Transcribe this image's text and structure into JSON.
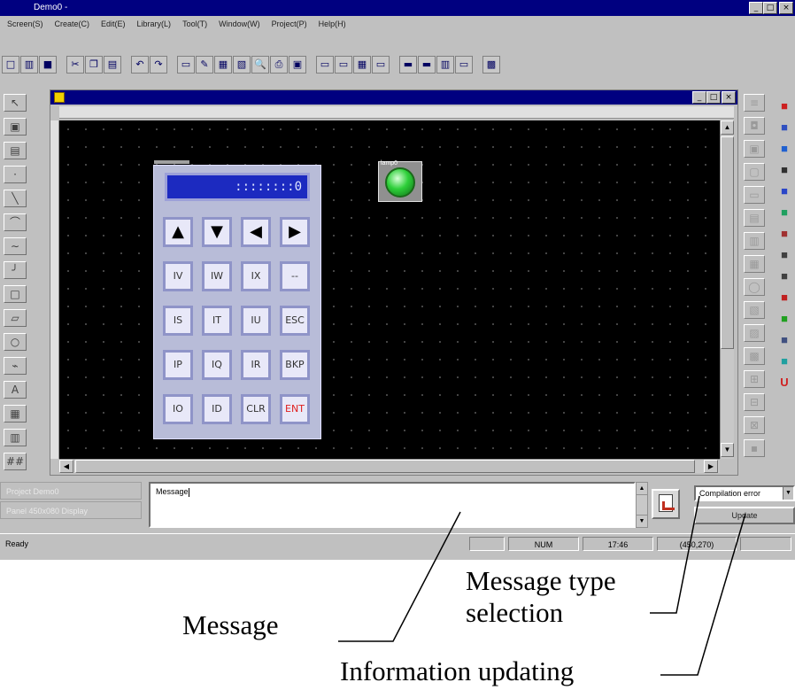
{
  "window": {
    "title": "Demo0 -",
    "controls": [
      "_",
      "□",
      "×"
    ]
  },
  "menu": [
    "Screen(S)",
    "Create(C)",
    "Edit(E)",
    "Library(L)",
    "Tool(T)",
    "Window(W)",
    "Project(P)",
    "Help(H)"
  ],
  "toolbar": {
    "icons": [
      "new-icon",
      "open-icon",
      "save-icon",
      "cut-icon",
      "copy-icon",
      "paste-icon",
      "undo-icon",
      "redo-icon",
      "screen-icon",
      "edit-icon",
      "tile-icon",
      "cascade-icon",
      "find-icon",
      "print-icon",
      "preview-icon",
      "view1-icon",
      "view2-icon",
      "grid-icon",
      "view3-icon",
      "layout1-icon",
      "layout2-icon",
      "layout3-icon",
      "layout4-icon",
      "library-icon"
    ]
  },
  "left_tools": [
    "↖",
    "▣",
    "▤",
    "·",
    "╲",
    "⌒",
    "∼",
    "╯",
    "□",
    "▱",
    "○",
    "⌁",
    "A",
    "▦",
    "▥",
    "##"
  ],
  "right_tools": [
    "≡",
    "◘",
    "▣",
    "▢",
    "▭",
    "▤",
    "▥",
    "▦",
    "◯",
    "▧",
    "▨",
    "▩",
    "⊞",
    "⊟",
    "⊠",
    "▪"
  ],
  "right_palette": [
    "■",
    "■",
    "■",
    "■",
    "■",
    "■",
    "■",
    "■",
    "■",
    "■",
    "■",
    "■",
    "■",
    "U"
  ],
  "palette_colors": [
    "#cc2020",
    "#3050c0",
    "#2060d0",
    "#303030",
    "#2a46c8",
    "#20a060",
    "#a03030",
    "#404040",
    "#404040",
    "#c02020",
    "#20a020",
    "#405080",
    "#20a0a0",
    "#d02020"
  ],
  "keypad": {
    "display": "::::::::0",
    "rows": [
      [
        "▲",
        "▼",
        "◀",
        "▶"
      ],
      [
        "IV",
        "IW",
        "IX",
        "--"
      ],
      [
        "IS",
        "IT",
        "IU",
        "ESC"
      ],
      [
        "IP",
        "IQ",
        "IR",
        "BKP"
      ],
      [
        "IO",
        "ID",
        "CLR",
        "ENT"
      ]
    ]
  },
  "lamp": {
    "label": "lamp0",
    "color": "#2ed03a"
  },
  "bottom": {
    "project_label": "Project Demo0",
    "panel_label": "Panel 450x080 Display",
    "message_text": "Message",
    "message_type": "Compilation error",
    "update_label": "Update"
  },
  "statusbar": {
    "left": "Ready",
    "num": "NUM",
    "time": "17:46",
    "coords": "(450,270)"
  },
  "annotations": {
    "message": "Message",
    "message_type_1": "Message type",
    "message_type_2": "selection",
    "info_update": "Information updating"
  }
}
